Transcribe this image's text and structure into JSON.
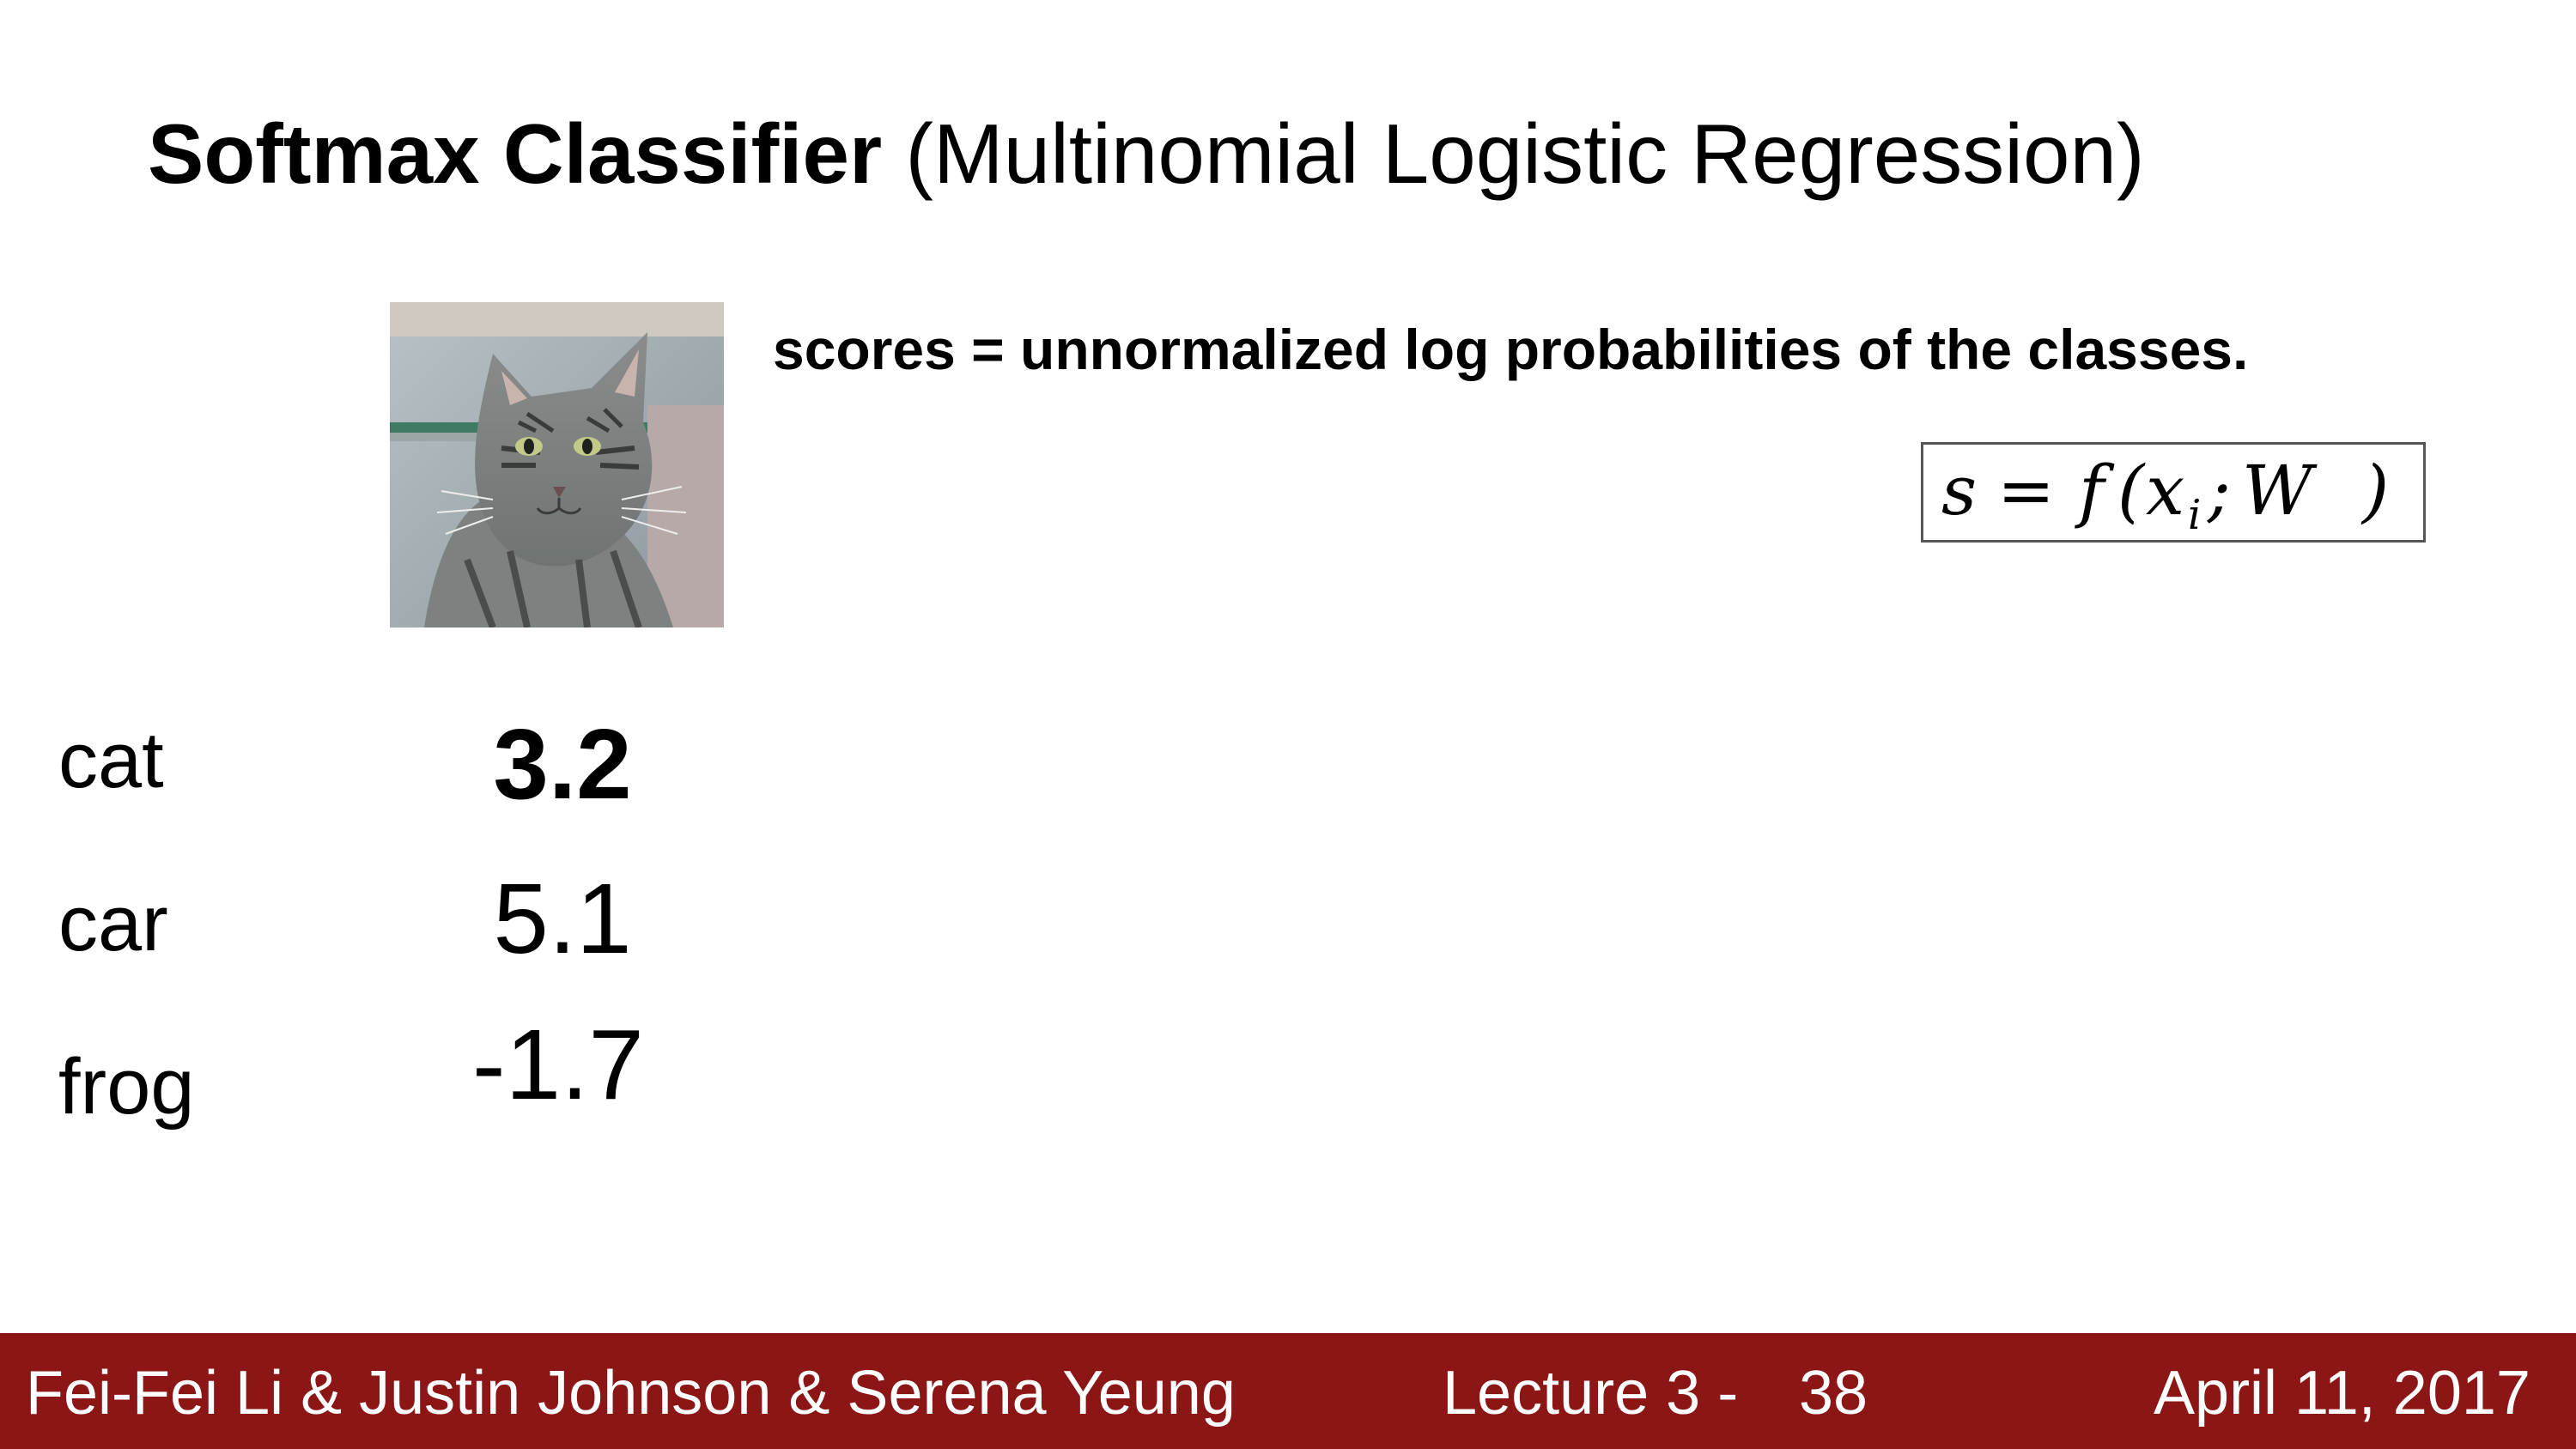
{
  "title": {
    "bold": "Softmax Classifier",
    "rest": " (Multinomial Logistic Regression)"
  },
  "scores_description": "scores = unnormalized log probabilities of the classes.",
  "formula": "s = f(x_i; W)",
  "classes": [
    {
      "label": "cat",
      "score": "3.2"
    },
    {
      "label": "car",
      "score": "5.1"
    },
    {
      "label": "frog",
      "score": "-1.7"
    }
  ],
  "footer": {
    "authors": "Fei-Fei Li & Justin Johnson & Serena Yeung",
    "lecture": "Lecture 3 -",
    "slide_number": "38",
    "date": "April 11, 2017"
  },
  "colors": {
    "footer_background": "#8c1515",
    "footer_text": "#ffffff"
  },
  "image": "cat-photo"
}
